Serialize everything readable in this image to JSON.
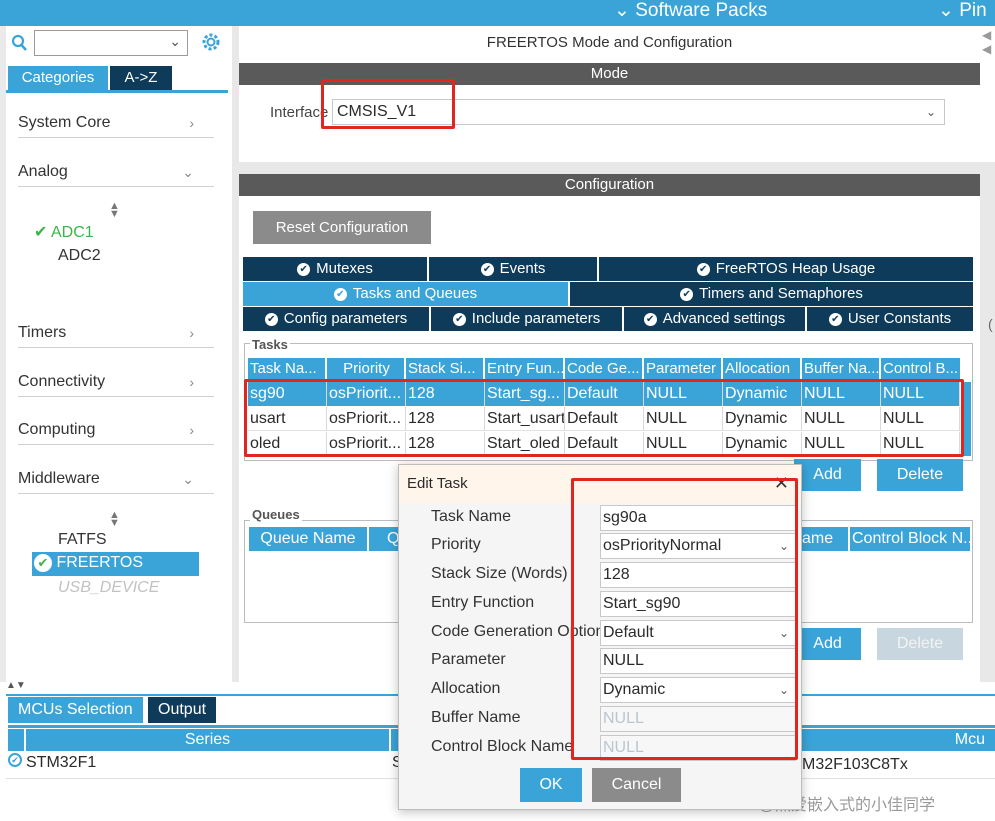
{
  "topbar": {
    "software_packs": "Software Packs",
    "pinout_truncated": "Pin"
  },
  "sidebar": {
    "search_placeholder": "",
    "tabs": {
      "categories": "Categories",
      "atoz": "A->Z"
    },
    "items": {
      "system_core": "System Core",
      "analog": "Analog",
      "timers": "Timers",
      "connectivity": "Connectivity",
      "computing": "Computing",
      "middleware": "Middleware"
    },
    "analog_children": {
      "adc1": "ADC1",
      "adc2": "ADC2"
    },
    "middleware_children": {
      "fatfs": "FATFS",
      "freertos": "FREERTOS",
      "usb_device": "USB_DEVICE"
    }
  },
  "main": {
    "title": "FREERTOS Mode and Configuration",
    "mode_header": "Mode",
    "interface_label": "Interface",
    "interface_value": "CMSIS_V1",
    "config_header": "Configuration",
    "reset_button": "Reset Configuration",
    "tabs_row1": {
      "mutexes": "Mutexes",
      "events": "Events",
      "heap": "FreeRTOS Heap Usage"
    },
    "tabs_row2": {
      "tasks": "Tasks and Queues",
      "timers": "Timers and Semaphores"
    },
    "tabs_row3": {
      "config": "Config parameters",
      "include": "Include parameters",
      "advanced": "Advanced settings",
      "user": "User Constants"
    },
    "tasks_legend": "Tasks",
    "task_columns": [
      "Task Na...",
      "Priority",
      "Stack Si...",
      "Entry Fun...",
      "Code Ge...",
      "Parameter",
      "Allocation",
      "Buffer Na...",
      "Control B..."
    ],
    "task_rows": [
      [
        "sg90",
        "osPriorit...",
        "128",
        "Start_sg...",
        "Default",
        "NULL",
        "Dynamic",
        "NULL",
        "NULL"
      ],
      [
        "usart",
        "osPriorit...",
        "128",
        "Start_usart",
        "Default",
        "NULL",
        "Dynamic",
        "NULL",
        "NULL"
      ],
      [
        "oled",
        "osPriorit...",
        "128",
        "Start_oled",
        "Default",
        "NULL",
        "Dynamic",
        "NULL",
        "NULL"
      ]
    ],
    "add_label": "Add",
    "delete_label": "Delete",
    "queues_legend": "Queues",
    "queue_columns": {
      "name": "Queue Name",
      "q": "Q",
      "ame": "ame",
      "control": "Control Block N..."
    }
  },
  "dialog": {
    "title": "Edit Task",
    "labels": {
      "task_name": "Task Name",
      "priority": "Priority",
      "stack_size": "Stack Size (Words)",
      "entry_function": "Entry Function",
      "code_gen": "Code Generation Option",
      "parameter": "Parameter",
      "allocation": "Allocation",
      "buffer_name": "Buffer Name",
      "control_block": "Control Block Name"
    },
    "values": {
      "task_name": "sg90a",
      "priority": "osPriorityNormal",
      "stack_size": "128",
      "entry_function": "Start_sg90",
      "code_gen": "Default",
      "parameter": "NULL",
      "allocation": "Dynamic",
      "buffer_name": "NULL",
      "control_block": "NULL"
    },
    "ok": "OK",
    "cancel": "Cancel"
  },
  "bottom": {
    "tabs": {
      "mcus": "MCUs Selection",
      "output": "Output"
    },
    "series_header": "Series",
    "mcu_header": "Mcu",
    "series_value": "STM32F1",
    "s_fragment": "S",
    "mcu_value": "M32F103C8Tx",
    "right_fragment": "("
  },
  "watermark": "CSDN @热爱嵌入式的小佳同学",
  "colors": {
    "accent": "#3aa4d9",
    "dark_tab": "#0e3b5a",
    "header_bar": "#5a5a5a",
    "highlight": "#e0261f",
    "check_green": "#3bb54a"
  }
}
